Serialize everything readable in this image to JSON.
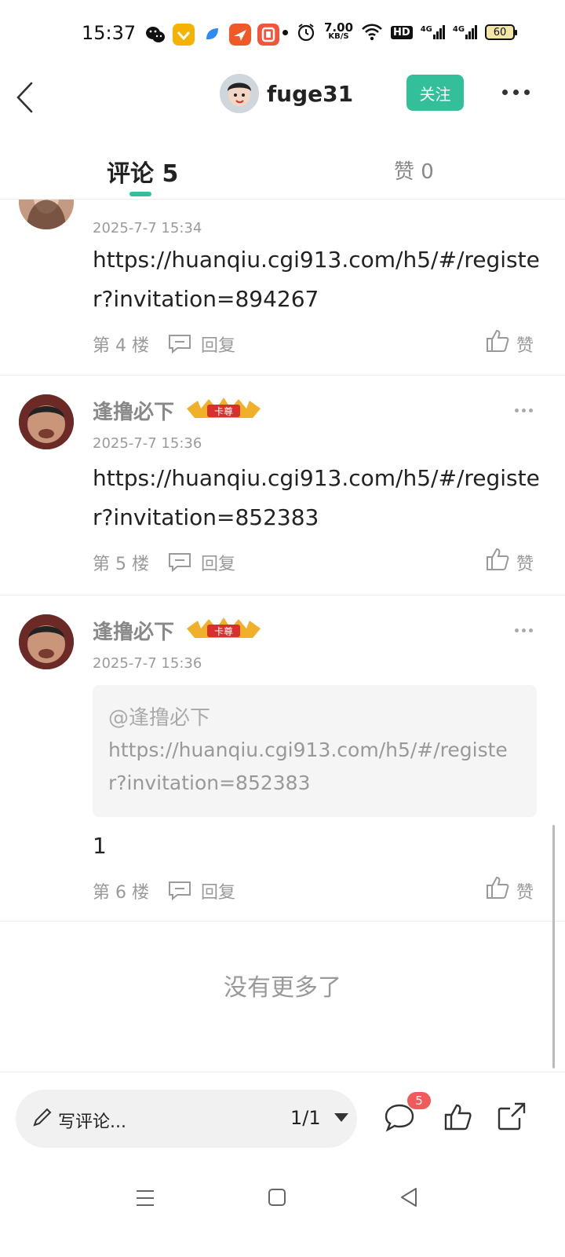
{
  "status_bar": {
    "time": "15:37",
    "net_speed_value": "7.00",
    "net_speed_unit": "KB/S",
    "hd_label": "HD",
    "signal1": "4G",
    "signal2": "4G",
    "battery": "60",
    "app_icons": [
      "wechat-icon",
      "app-yellow-icon",
      "app-blue-icon",
      "app-orange-icon",
      "app-red-icon"
    ]
  },
  "header": {
    "username": "fuge31",
    "follow_label": "关注"
  },
  "tabs": {
    "comments_label": "评论 5",
    "likes_label": "赞 0"
  },
  "comments": [
    {
      "time": "2025-7-7 15:34",
      "text": "https://huanqiu.cgi913.com/h5/#/register?invitation=894267",
      "floor": "第 4 楼",
      "reply_label": "回复",
      "like_label": "赞"
    },
    {
      "name": "逢撸必下",
      "badge": "卡尊",
      "time": "2025-7-7 15:36",
      "text": "https://huanqiu.cgi913.com/h5/#/register?invitation=852383",
      "floor": "第 5 楼",
      "reply_label": "回复",
      "like_label": "赞"
    },
    {
      "name": "逢撸必下",
      "badge": "卡尊",
      "time": "2025-7-7 15:36",
      "quote_user": "@逢撸必下",
      "quote_text": "https://huanqiu.cgi913.com/h5/#/register?invitation=852383",
      "text": "1",
      "floor": "第 6 楼",
      "reply_label": "回复",
      "like_label": "赞"
    }
  ],
  "list_end": "没有更多了",
  "bottom_bar": {
    "composer_placeholder": "写评论...",
    "page_indicator": "1/1",
    "comment_count_badge": "5"
  },
  "colors": {
    "accent": "#34bf9b",
    "badge_red": "#ef5a5a"
  }
}
